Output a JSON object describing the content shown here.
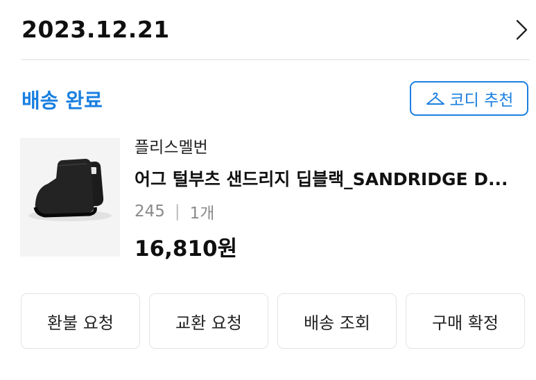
{
  "order": {
    "date": "2023.12.21",
    "status": "배송 완료",
    "codi_button": "코디 추천"
  },
  "item": {
    "brand": "플리스멜번",
    "name": "어그 털부츠 샌드리지 딥블랙_SANDRIDGE D...",
    "size": "245",
    "separator": "|",
    "quantity": "1개",
    "price": "16,810원"
  },
  "actions": [
    {
      "label": "환불 요청"
    },
    {
      "label": "교환 요청"
    },
    {
      "label": "배송 조회"
    },
    {
      "label": "구매 확정"
    }
  ],
  "colors": {
    "accent": "#1a7fe0",
    "text": "#111111",
    "muted": "#8a8a8a",
    "border": "#e3e3e3"
  },
  "icons": {
    "header_right": "chevron-right-icon",
    "codi": "hanger-icon",
    "product": "black-boot-thumbnail"
  }
}
